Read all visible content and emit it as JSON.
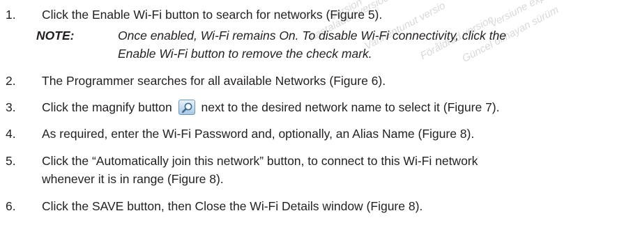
{
  "steps": [
    {
      "number": "1.",
      "text": "Click the Enable Wi-Fi button to search for networks (Figure 5)."
    },
    {
      "number": "2.",
      "text": "The Programmer searches for all available Networks (Figure 6)."
    },
    {
      "number": "3.",
      "text_before": "Click the magnify button",
      "text_after": "next to the desired network name to select it (Figure 7)."
    },
    {
      "number": "4.",
      "text": "As required, enter the Wi-Fi Password and, optionally, an Alias Name (Figure 8)."
    },
    {
      "number": "5.",
      "line1": "Click the “Automatically join this network” button, to connect to this Wi-Fi network",
      "line2": "whenever it is in range (Figure 8)."
    },
    {
      "number": "6.",
      "text": "Click the SAVE button, then Close the Wi-Fi Details window (Figure 8)."
    }
  ],
  "note": {
    "label": "NOTE:",
    "line1": "Once enabled, Wi-Fi remains On. To disable Wi-Fi connectivity, click the",
    "line2": "Enable Wi-Fi button to remove the check mark."
  },
  "icons": {
    "magnify_button": "magnify-icon"
  },
  "watermarks": [
    {
      "text": "Version"
    },
    {
      "text": "Aastaladud versioon"
    },
    {
      "text": "Vanhentunut versio"
    },
    {
      "text": "Föråldrad version"
    },
    {
      "text": "Güncel olmayan sürüm"
    },
    {
      "text": "Versiune expirată"
    }
  ]
}
